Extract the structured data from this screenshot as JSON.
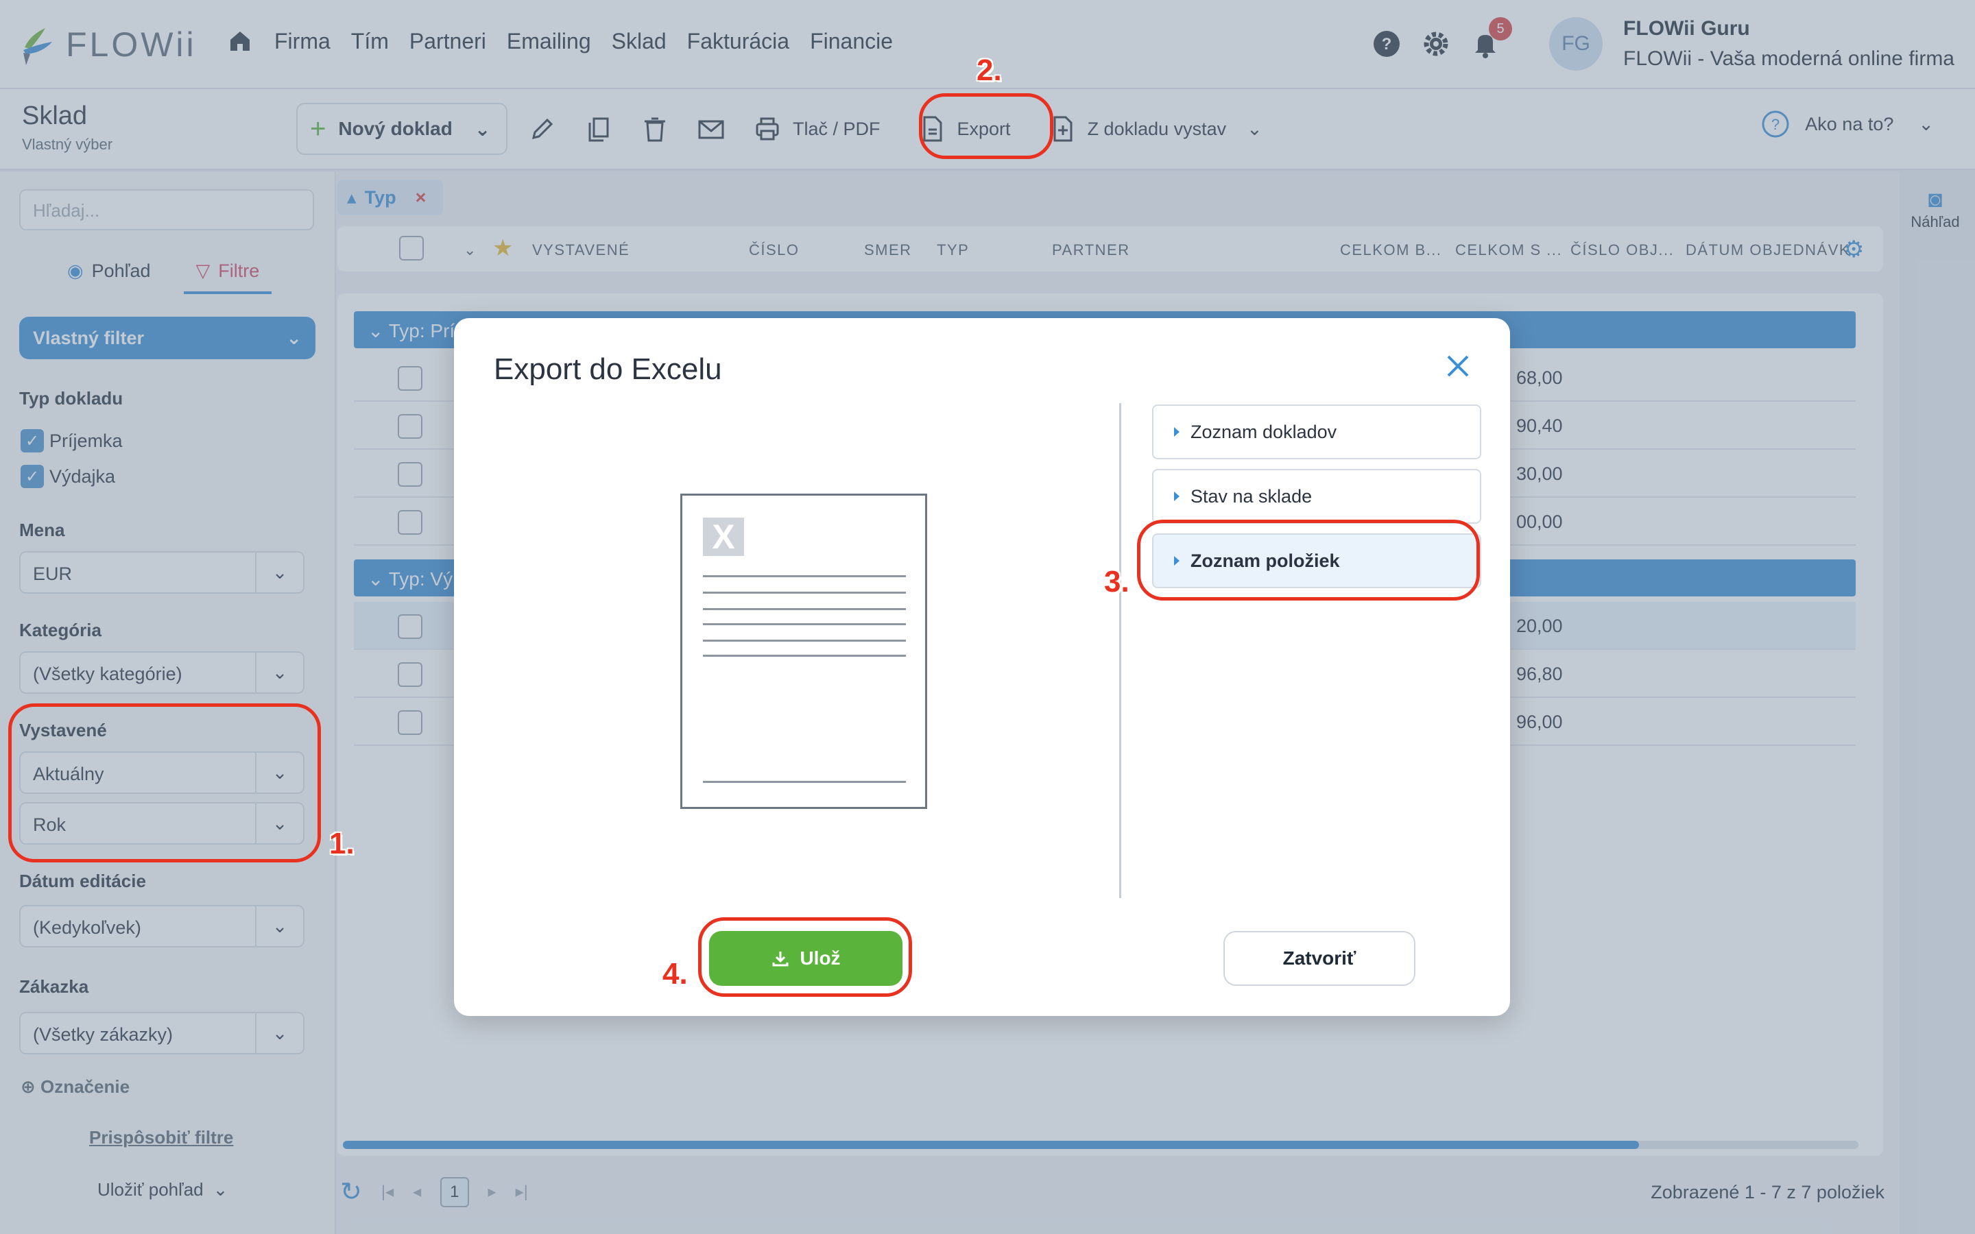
{
  "app": {
    "logo_text": "FLOWii",
    "nav": [
      "Firma",
      "Tím",
      "Partneri",
      "Emailing",
      "Sklad",
      "Fakturácia",
      "Financie"
    ],
    "notifications_count": "5",
    "avatar_initials": "FG",
    "user_name": "FLOWii Guru",
    "user_company": "FLOWii - Vaša moderná online firma"
  },
  "toolbar": {
    "page_title": "Sklad",
    "page_subtitle": "Vlastný výber",
    "new_doc_label": "Nový doklad",
    "print_label": "Tlač / PDF",
    "export_label": "Export",
    "from_doc_label": "Z dokladu vystav",
    "help_label": "Ako na to?"
  },
  "sidebar": {
    "search_placeholder": "Hľadaj...",
    "tab_view": "Pohľad",
    "tab_filters": "Filtre",
    "custom_filter": "Vlastný filter",
    "doc_type_label": "Typ dokladu",
    "doc_types": [
      "Príjemka",
      "Výdajka"
    ],
    "currency_label": "Mena",
    "currency_value": "EUR",
    "category_label": "Kategória",
    "category_value": "(Všetky kategórie)",
    "issued_label": "Vystavené",
    "issued_value1": "Aktuálny",
    "issued_value2": "Rok",
    "edit_date_label": "Dátum editácie",
    "edit_date_value": "(Kedykoľvek)",
    "order_label": "Zákazka",
    "order_value": "(Všetky zákazky)",
    "marking_label": "Označenie",
    "customize_link": "Prispôsobiť filtre",
    "save_view": "Uložiť pohľad"
  },
  "grid": {
    "group_chip": "Typ",
    "columns": [
      "VYSTAVENÉ",
      "ČÍSLO",
      "SMER",
      "TYP",
      "PARTNER",
      "CELKOM B...",
      "CELKOM S ...",
      "ČÍSLO OBJ...",
      "DÁTUM OBJEDNÁVK"
    ],
    "group1": "Typ: Prí",
    "group2": "Typ: Vý",
    "rows_group1": [
      "68,00",
      "90,40",
      "30,00",
      "00,00"
    ],
    "rows_group2": [
      "20,00",
      "96,80",
      "96,00"
    ],
    "page": "1",
    "pager_info": "Zobrazené 1 - 7 z 7 položiek",
    "preview_label": "Náhľad"
  },
  "modal": {
    "title": "Export do Excelu",
    "options": [
      "Zoznam dokladov",
      "Stav na sklade",
      "Zoznam položiek"
    ],
    "save_label": "Ulož",
    "close_label": "Zatvoriť"
  },
  "annotations": {
    "step1": "1.",
    "step2": "2.",
    "step3": "3.",
    "step4": "4.",
    "color": "#e8321f"
  }
}
